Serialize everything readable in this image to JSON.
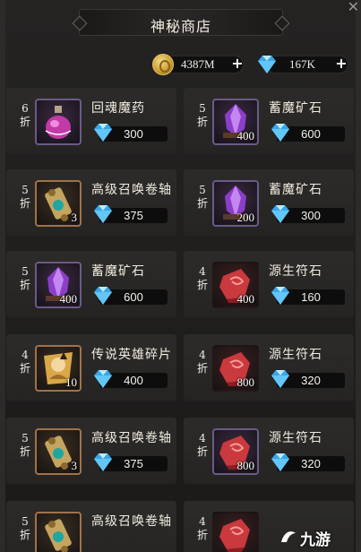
{
  "header": {
    "title": "神秘商店"
  },
  "currencies": [
    {
      "name": "gold",
      "amount": "4387M"
    },
    {
      "name": "diamond",
      "amount": "167K"
    }
  ],
  "items": [
    {
      "discount": "6折",
      "name": "回魂魔药",
      "qty": "",
      "price": "300",
      "icon": "potion-icon",
      "frame": "purple"
    },
    {
      "discount": "5折",
      "name": "蓄魔矿石",
      "qty": "400",
      "price": "600",
      "icon": "purple-crystal-icon",
      "frame": "purple"
    },
    {
      "discount": "5折",
      "name": "高级召唤卷轴",
      "qty": "3",
      "price": "375",
      "icon": "scroll-icon",
      "frame": "gold"
    },
    {
      "discount": "5折",
      "name": "蓄魔矿石",
      "qty": "200",
      "price": "300",
      "icon": "purple-crystal-icon",
      "frame": "purple"
    },
    {
      "discount": "5折",
      "name": "蓄魔矿石",
      "qty": "400",
      "price": "600",
      "icon": "purple-crystal-icon",
      "frame": "purple"
    },
    {
      "discount": "4折",
      "name": "源生符石",
      "qty": "400",
      "price": "160",
      "icon": "red-rune-stone-icon",
      "frame": "none"
    },
    {
      "discount": "4折",
      "name": "传说英雄碎片",
      "qty": "10",
      "price": "400",
      "icon": "hero-shard-icon",
      "frame": "gold"
    },
    {
      "discount": "4折",
      "name": "源生符石",
      "qty": "800",
      "price": "320",
      "icon": "red-rune-stone-icon",
      "frame": "none"
    },
    {
      "discount": "5折",
      "name": "高级召唤卷轴",
      "qty": "3",
      "price": "375",
      "icon": "scroll-icon",
      "frame": "gold"
    },
    {
      "discount": "4折",
      "name": "源生符石",
      "qty": "800",
      "price": "320",
      "icon": "red-rune-stone-icon",
      "frame": "purple"
    },
    {
      "discount": "5折",
      "name": "高级召唤卷轴",
      "qty": "",
      "price": "",
      "icon": "scroll-icon",
      "frame": "gold"
    },
    {
      "discount": "4折",
      "name": "",
      "qty": "",
      "price": "",
      "icon": "red-rune-stone-icon",
      "frame": "none"
    }
  ],
  "watermark": {
    "text": "九游"
  },
  "colors": {
    "diamond": "#4fb6f0",
    "gold": "#d7a93c",
    "card": "#2a2927",
    "purple_frame": "#6b5a88",
    "gold_frame": "#a0724a"
  }
}
